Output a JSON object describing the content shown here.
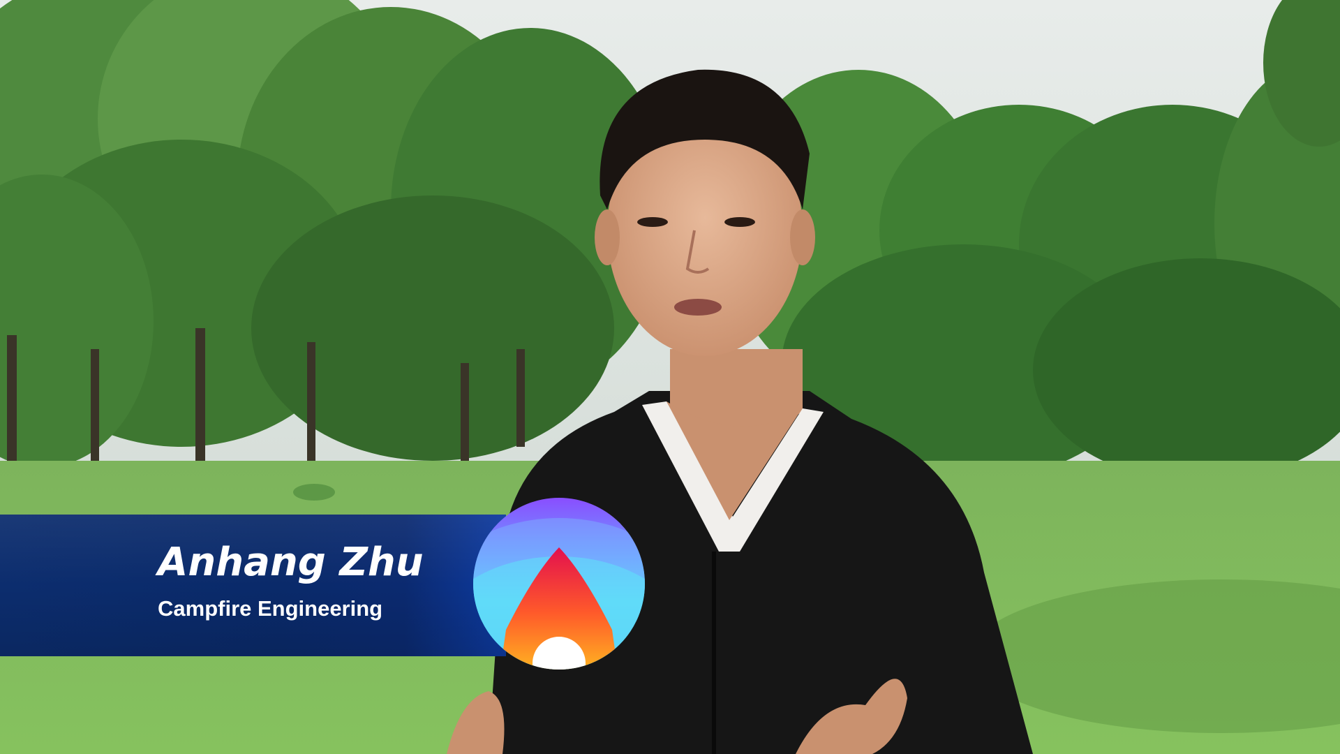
{
  "lower_third": {
    "name": "Anhang Zhu",
    "title": "Campfire Engineering"
  },
  "colors": {
    "banner": "#0c2d6e",
    "text": "#ffffff",
    "sky": "#dfe6e4",
    "grass": "#7fb85a",
    "trees": "#3f7a35",
    "hoodie": "#141414",
    "logo_top": "#8a4dff",
    "logo_mid": "#52dcf5",
    "flame_top": "#e8174a",
    "flame_bottom": "#ffb21e"
  },
  "icons": [
    "campfire-logo-icon"
  ]
}
